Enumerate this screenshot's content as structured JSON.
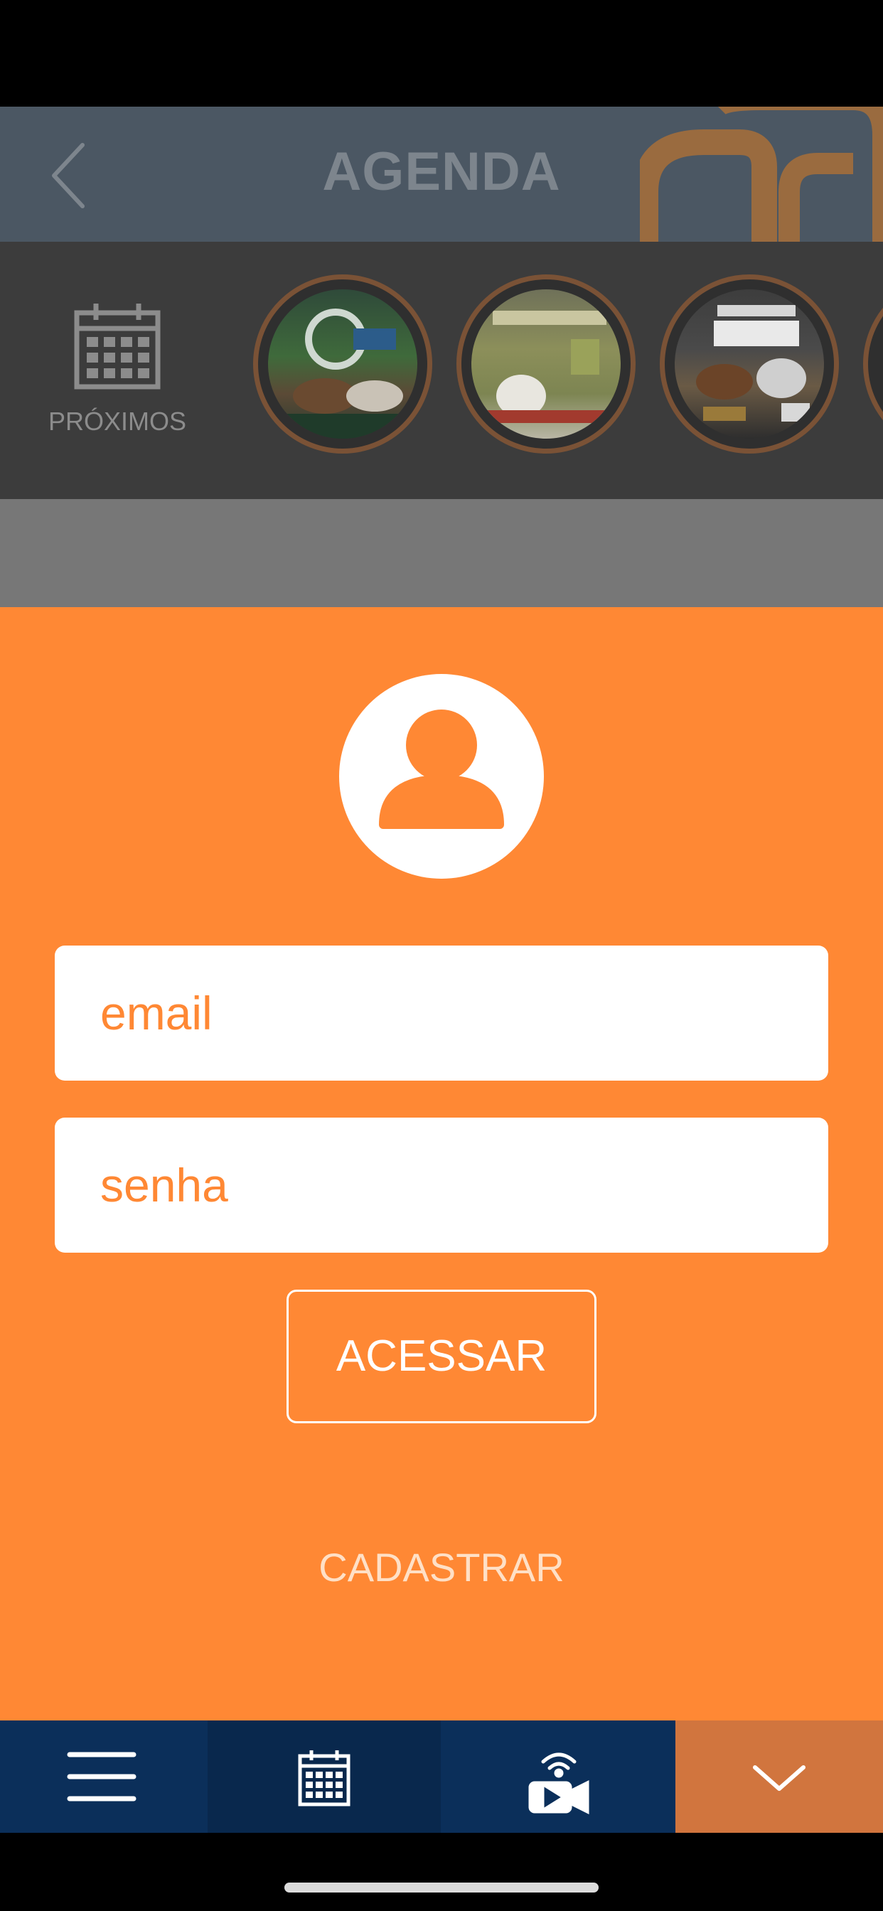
{
  "header": {
    "title": "AGENDA"
  },
  "events_bar": {
    "calendar_label": "PRÓXIMOS",
    "events": [
      {
        "name": "event-1"
      },
      {
        "name": "event-2"
      },
      {
        "name": "event-3"
      }
    ]
  },
  "login": {
    "email_placeholder": "email",
    "password_placeholder": "senha",
    "submit_label": "ACESSAR",
    "register_label": "CADASTRAR"
  },
  "bottom_nav": {
    "items": [
      "menu-icon",
      "calendar-icon",
      "live-camera-icon",
      "chevron-down-icon"
    ]
  },
  "colors": {
    "accent": "#ff8834",
    "nav_blue": "#0b2f5a",
    "nav_blue_dark": "#09284d",
    "header": "#4b5763"
  }
}
